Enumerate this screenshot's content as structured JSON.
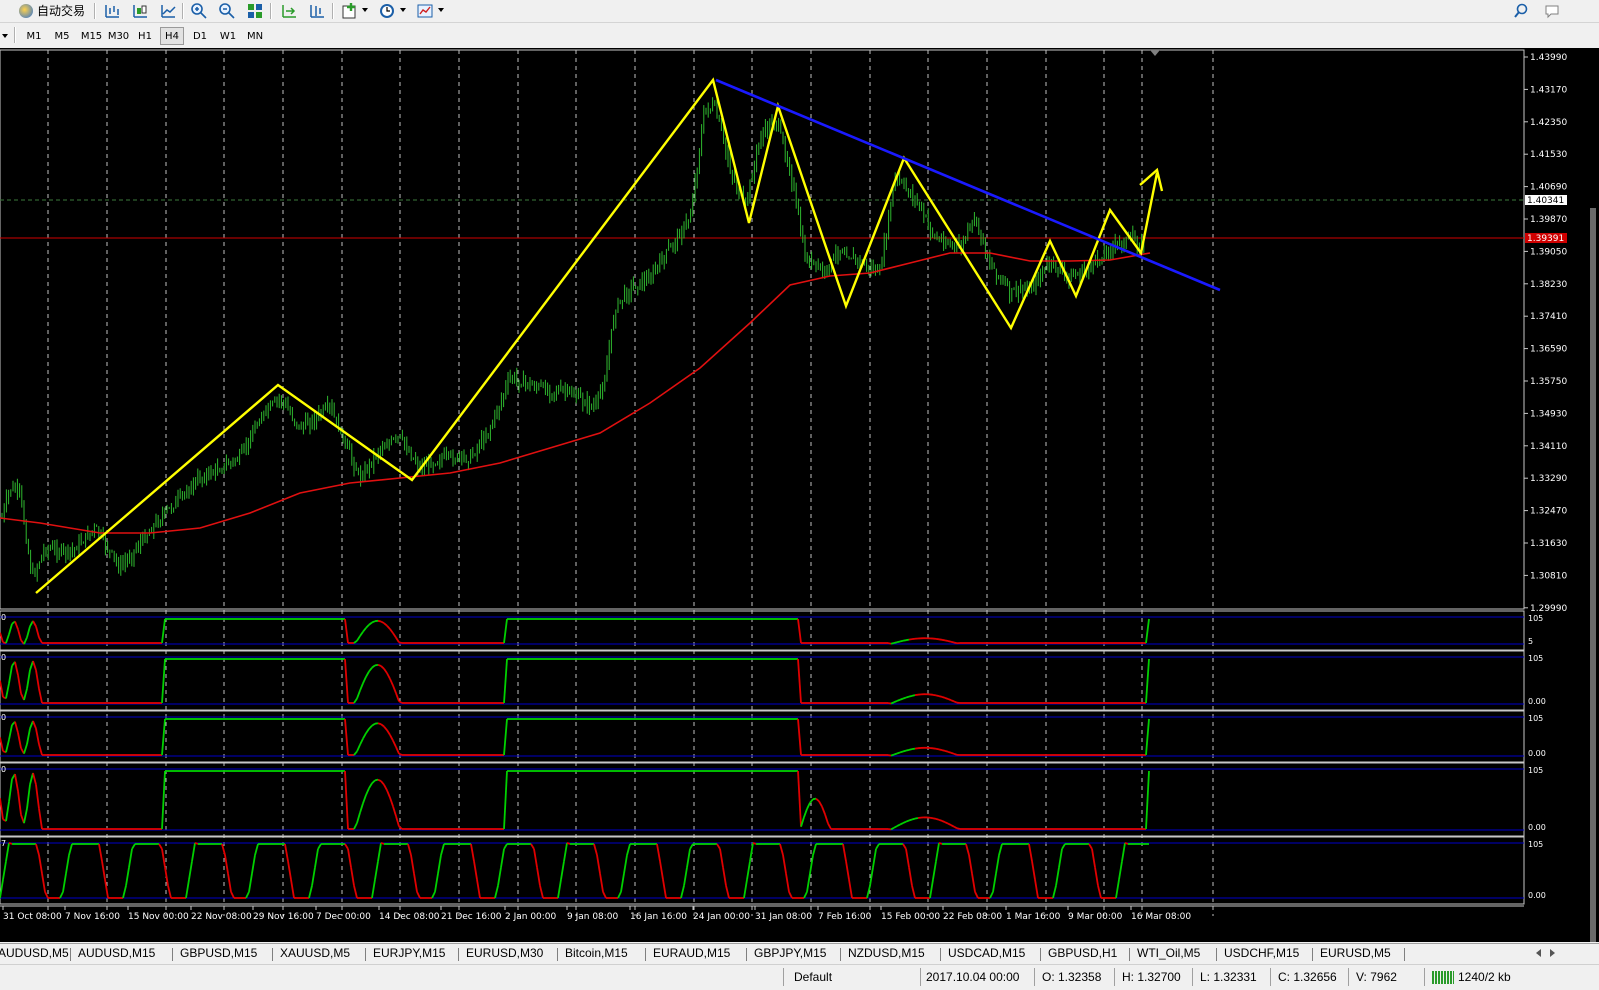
{
  "toolbar": {
    "autotrade_label": "自动交易",
    "icons": [
      "bar-chart-icon",
      "candlestick-icon",
      "line-chart-icon",
      "zoom-in-icon",
      "zoom-out-icon",
      "tile-windows-icon",
      "autoscroll-icon",
      "chart-shift-icon",
      "indicators-icon",
      "periodicity-icon",
      "templates-icon",
      "search-icon",
      "chat-icon"
    ]
  },
  "timeframes": [
    "M1",
    "M5",
    "M15",
    "M30",
    "H1",
    "H4",
    "D1",
    "W1",
    "MN"
  ],
  "active_timeframe": "H4",
  "chart": {
    "price_labels": [
      "1.43990",
      "1.43170",
      "1.42350",
      "1.41530",
      "1.40690",
      "1.39870",
      "1.39050",
      "1.38230",
      "1.37410",
      "1.36590",
      "1.35750",
      "1.34930",
      "1.34110",
      "1.33290",
      "1.32470",
      "1.31630",
      "1.30810",
      "1.29990"
    ],
    "ask_label": "1.40341",
    "bid_label": "1.39391",
    "date_labels": [
      "31 Oct 08:00",
      "7 Nov 16:00",
      "15 Nov 00:00",
      "22 Nov 08:00",
      "29 Nov 16:00",
      "7 Dec 00:00",
      "14 Dec 08:00",
      "21 Dec 16:00",
      "2 Jan 00:00",
      "9 Jan 08:00",
      "16 Jan 16:00",
      "24 Jan 00:00",
      "31 Jan 08:00",
      "7 Feb 16:00",
      "15 Feb 00:00",
      "22 Feb 08:00",
      "1 Mar 16:00",
      "9 Mar 00:00",
      "16 Mar 08:00"
    ],
    "indicator_scale_top": "105",
    "indicator_scale_bottom": "-5",
    "indicator_bottom_labels": [
      "5",
      "0.00",
      "0.00",
      "0.00",
      "0.00"
    ],
    "indicator_left_labels": [
      "0",
      "0",
      "0",
      "0",
      "7"
    ],
    "colors": {
      "background": "#000000",
      "grid": "#c0c0c0",
      "candles": "#2fb82f",
      "moving_average": "#e01010",
      "pattern": "#ffff00",
      "trendline": "#1a1aff",
      "ask_line": "#3c7a3c",
      "bid_line": "#d00000",
      "indicator_up": "#00d000",
      "indicator_down": "#e00000",
      "indicator_level": "#0000c8"
    }
  },
  "symbol_tabs": [
    "AUDUSD,M5",
    "AUDUSD,M15",
    "GBPUSD,M15",
    "XAUUSD,M5",
    "EURJPY,M15",
    "EURUSD,M30",
    "Bitcoin,M15",
    "EURAUD,M15",
    "GBPJPY,M15",
    "NZDUSD,M15",
    "USDCAD,M15",
    "GBPUSD,H1",
    "WTI_Oil,M5",
    "USDCHF,M15",
    "EURUSD,M5"
  ],
  "status": {
    "profile": "Default",
    "datetime": "2017.10.04 00:00",
    "open": "O: 1.32358",
    "high": "H: 1.32700",
    "low": "L: 1.32331",
    "close": "C: 1.32656",
    "volume": "V: 7962",
    "traffic": "1240/2 kb"
  }
}
